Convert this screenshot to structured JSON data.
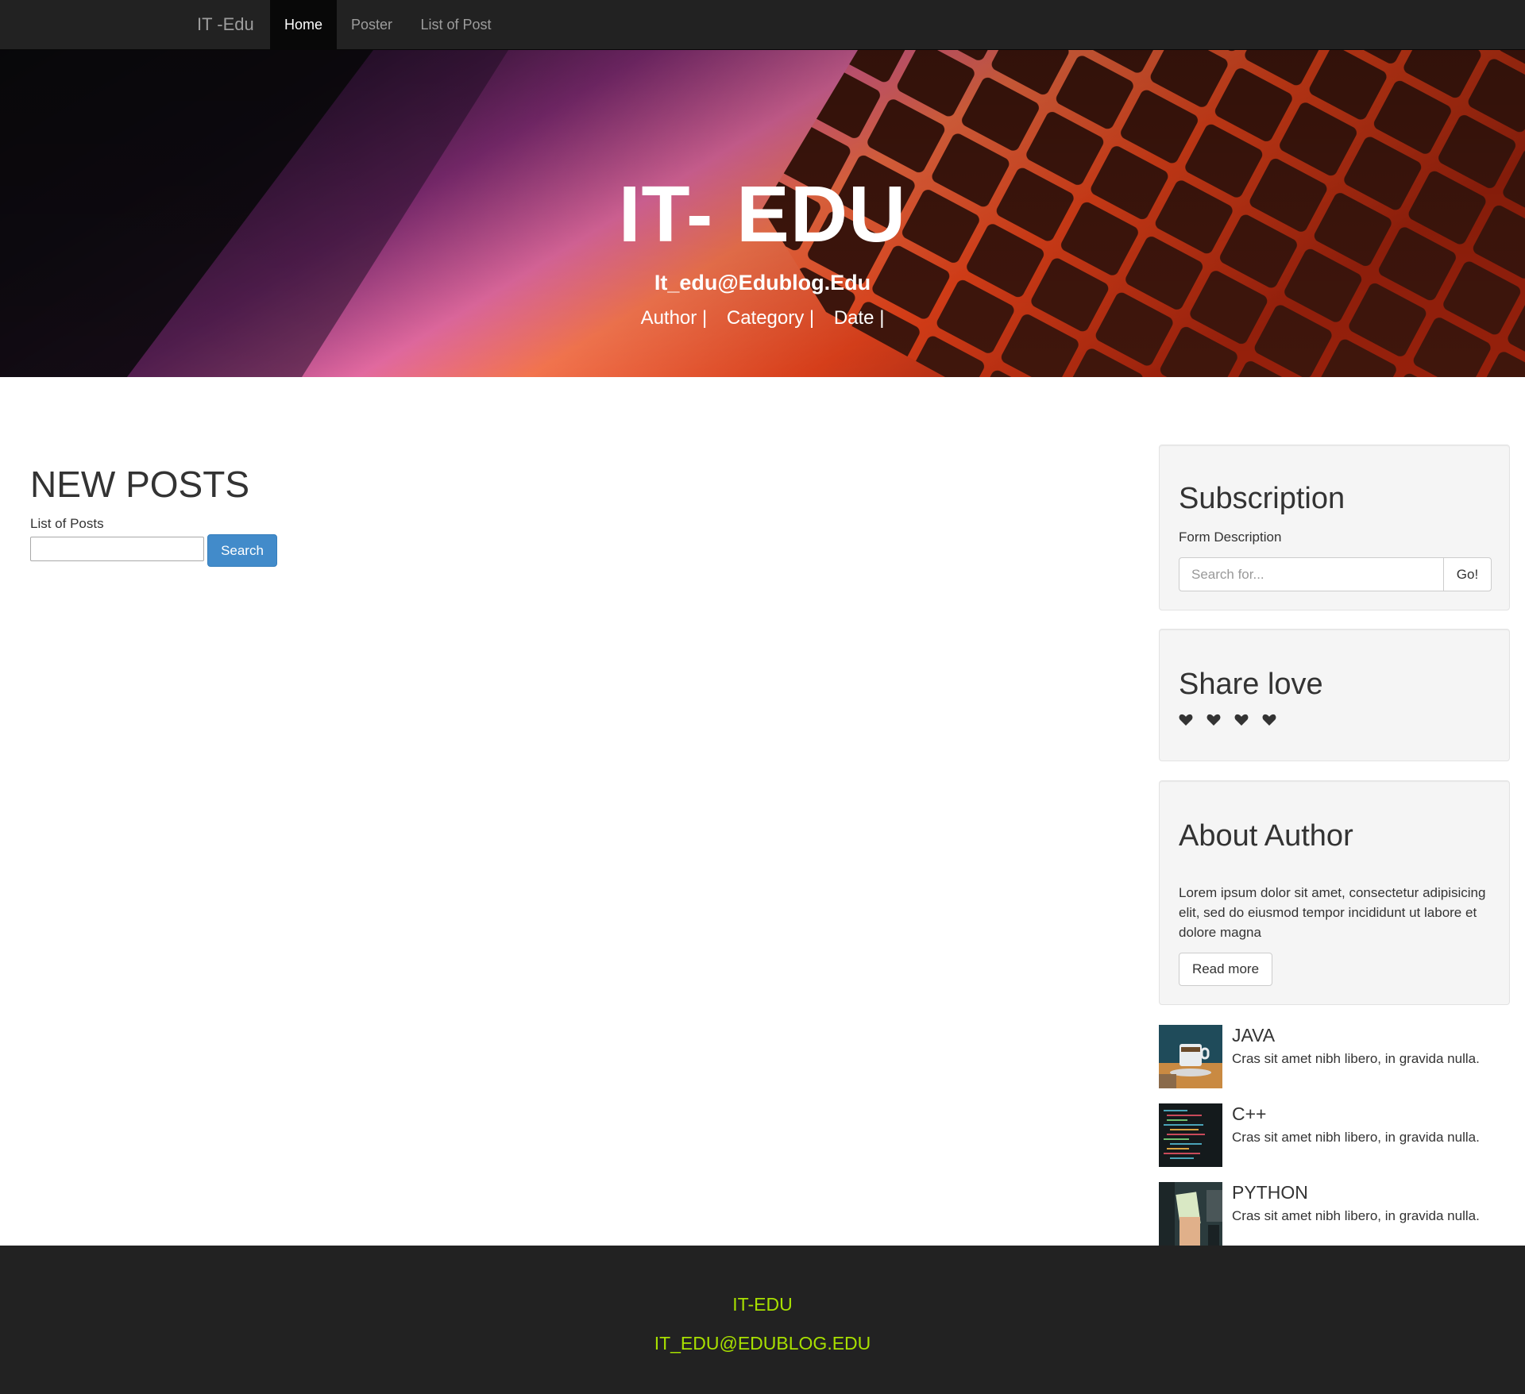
{
  "navbar": {
    "brand": "IT -Edu",
    "items": [
      {
        "label": "Home",
        "active": true
      },
      {
        "label": "Poster",
        "active": false
      },
      {
        "label": "List of Post",
        "active": false
      }
    ]
  },
  "hero": {
    "title": "IT- EDU",
    "email": "It_edu@Edublog.Edu",
    "meta": [
      "Author |",
      "Category |",
      "Date |"
    ]
  },
  "main": {
    "heading": "NEW POSTS",
    "label": "List of Posts",
    "search_input_value": "",
    "search_button": "Search"
  },
  "sidebar": {
    "subscription": {
      "title": "Subscription",
      "description": "Form Description",
      "input_placeholder": "Search for...",
      "button": "Go!"
    },
    "share": {
      "title": "Share love",
      "hearts": [
        "heart-icon",
        "heart-icon",
        "heart-icon",
        "heart-icon"
      ]
    },
    "about": {
      "title": "About Author",
      "text": "Lorem ipsum dolor sit amet, consectetur adipisicing elit, sed do eiusmod tempor incididunt ut labore et dolore magna",
      "button": "Read more"
    },
    "media": [
      {
        "title": "JAVA",
        "text": "Cras sit amet nibh libero, in gravida nulla."
      },
      {
        "title": "C++",
        "text": "Cras sit amet nibh libero, in gravida nulla."
      },
      {
        "title": "PYTHON",
        "text": "Cras sit amet nibh libero, in gravida nulla."
      }
    ]
  },
  "footer": {
    "title": "IT-EDU",
    "email": "IT_EDU@EDUBLOG.EDU"
  },
  "colors": {
    "navbar_bg": "#222222",
    "primary_button": "#428bca",
    "footer_text": "#a8e000",
    "keyboard_glow": "#ff5a1f"
  }
}
